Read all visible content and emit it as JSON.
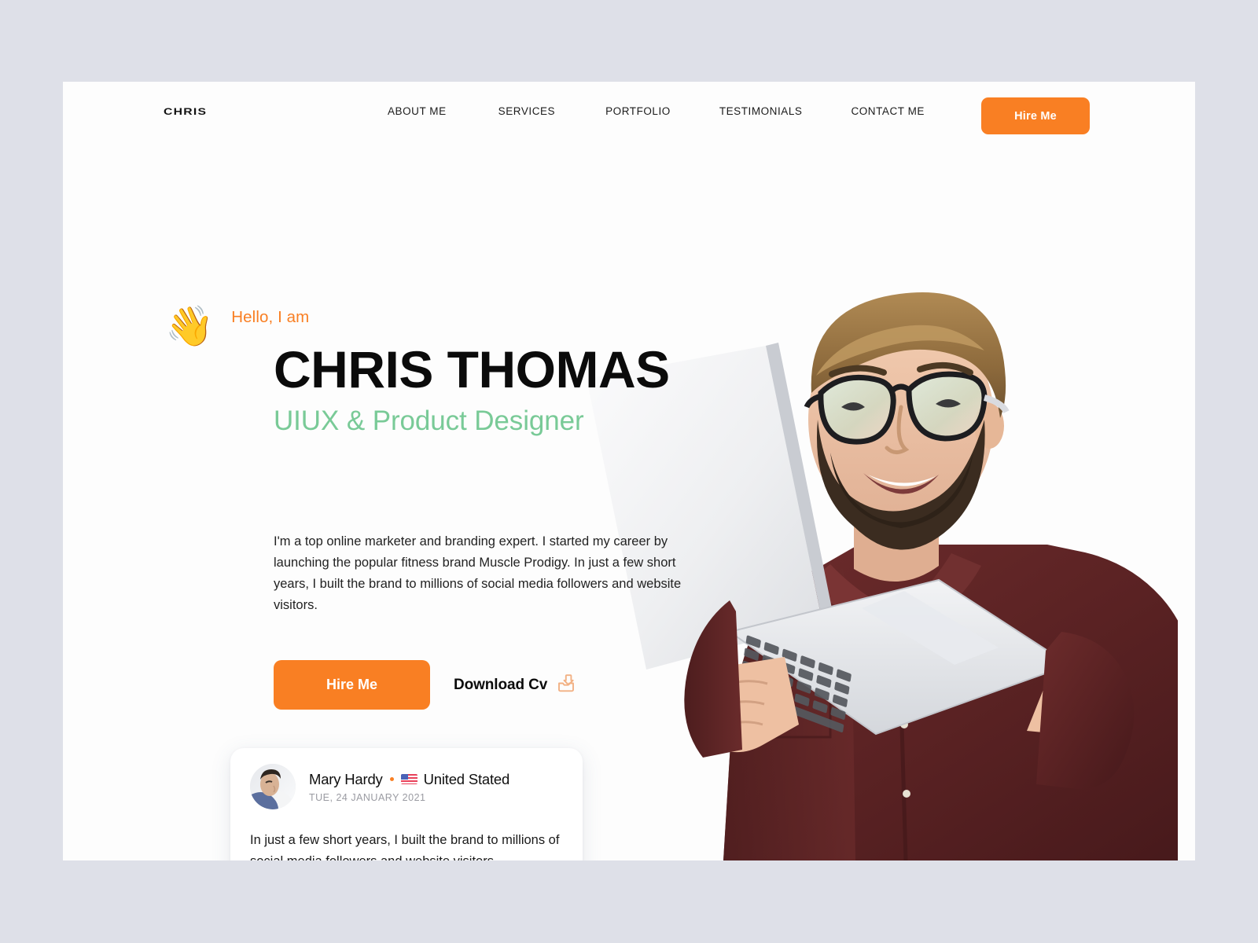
{
  "theme": {
    "page_background": "#dee0e8",
    "canvas_background": "#fdfdfd",
    "accent_orange": "#f97f23",
    "accent_green": "#79ca97",
    "text_dark": "#0b0b0b",
    "text_muted": "#9a9ba2"
  },
  "header": {
    "logo": "CHRIS",
    "nav": [
      {
        "label": "ABOUT ME"
      },
      {
        "label": "SERVICES"
      },
      {
        "label": "PORTFOLIO"
      },
      {
        "label": "TESTIMONIALS"
      },
      {
        "label": "CONTACT ME"
      }
    ],
    "cta_label": "Hire Me"
  },
  "hero": {
    "wave_emoji": "👋",
    "greeting": "Hello, I am",
    "name": "CHRIS THOMAS",
    "role": "UIUX & Product  Designer",
    "description": "I'm a top online marketer and branding expert. I started my career by launching the popular fitness brand Muscle Prodigy. In just a few short years, I built the brand to millions of social media followers and website visitors.",
    "primary_cta": "Hire Me",
    "secondary_cta": "Download Cv",
    "secondary_cta_icon": "download-tray-icon",
    "photo_alt": "man-with-laptop-photo"
  },
  "testimonial": {
    "avatar_alt": "reviewer-avatar",
    "author": "Mary Hardy",
    "separator": "•",
    "flag_icon": "us-flag-icon",
    "country": "United Stated",
    "date": "TUE, 24 JANUARY 2021",
    "quote": "In just a few short years, I built the brand to millions of social media followers and website visitors."
  }
}
